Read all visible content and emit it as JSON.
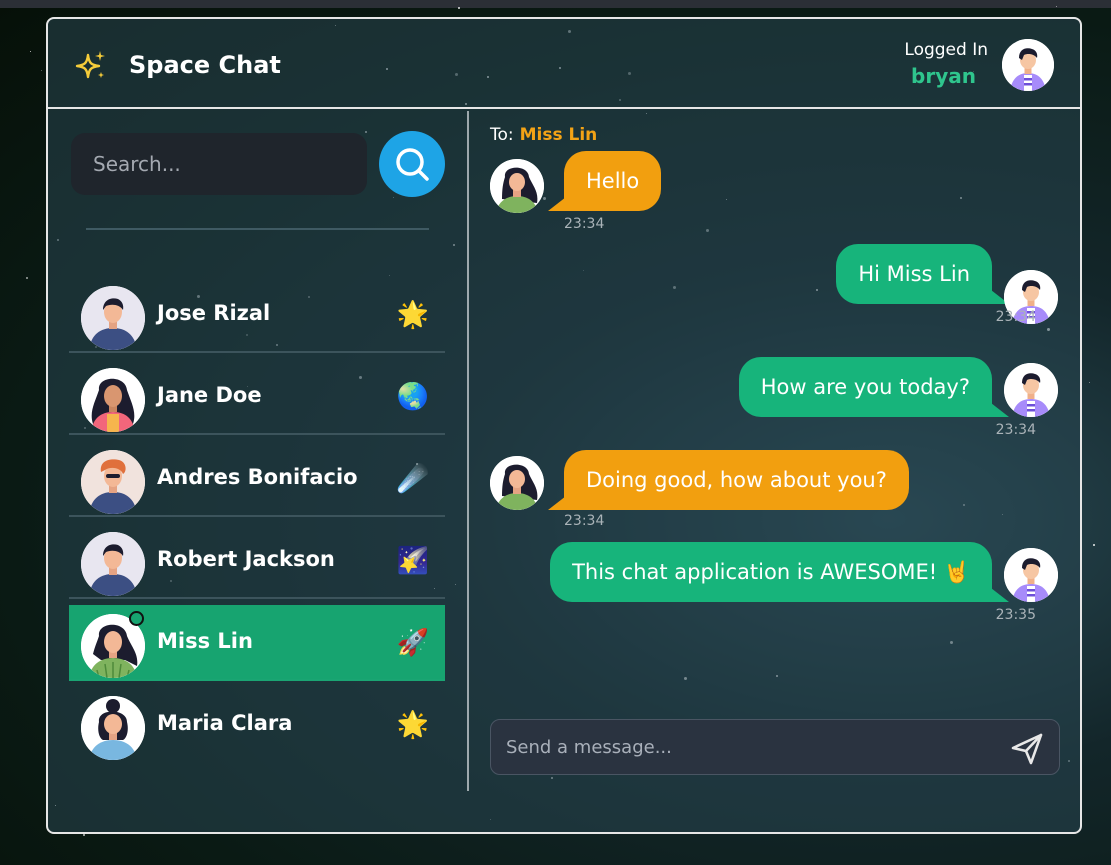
{
  "app": {
    "title": "Space Chat",
    "brand_icon": "sparkles-icon"
  },
  "header": {
    "logged_in_label": "Logged In",
    "username": "bryan"
  },
  "search": {
    "placeholder": "Search..."
  },
  "contacts": [
    {
      "name": "Jose Rizal",
      "emoji": "🌟",
      "active": false
    },
    {
      "name": "Jane Doe",
      "emoji": "🌏",
      "active": false
    },
    {
      "name": "Andres Bonifacio",
      "emoji": "☄️",
      "active": false
    },
    {
      "name": "Robert Jackson",
      "emoji": "🌠",
      "active": false
    },
    {
      "name": "Miss Lin",
      "emoji": "🚀",
      "active": true,
      "online": true
    },
    {
      "name": "Maria Clara",
      "emoji": "🌟",
      "active": false
    }
  ],
  "chat": {
    "to_label": "To:",
    "to_name": "Miss Lin",
    "messages": [
      {
        "dir": "in",
        "text": "Hello",
        "time": "23:34"
      },
      {
        "dir": "out",
        "text": "Hi Miss Lin",
        "time": "23:34"
      },
      {
        "dir": "out",
        "text": "How are you today?",
        "time": "23:34"
      },
      {
        "dir": "in",
        "text": "Doing good, how about you?",
        "time": "23:34"
      },
      {
        "dir": "out",
        "text": "This chat application is AWESOME! 🤘",
        "time": "23:35"
      }
    ],
    "composer_placeholder": "Send a message..."
  },
  "colors": {
    "accent_green": "#17a470",
    "incoming": "#f29f0f",
    "outgoing": "#17b47b",
    "search_button": "#1ea4e6"
  }
}
